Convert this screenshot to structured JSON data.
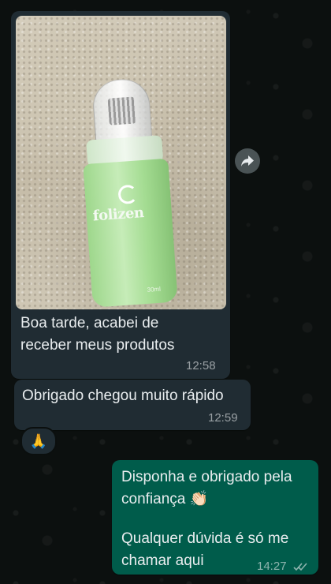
{
  "messages": [
    {
      "direction": "incoming",
      "type": "image",
      "image": {
        "product_brand": "folizen",
        "bottle_small_print": "30ml"
      },
      "text": "Boa tarde, acabei de receber meus produtos",
      "time": "12:58"
    },
    {
      "direction": "incoming",
      "type": "text",
      "text": "Obrigado chegou muito rápido",
      "time": "12:59",
      "reaction": "🙏"
    },
    {
      "direction": "outgoing",
      "type": "text",
      "text_line1": "Disponha e obrigado pela confiança 👏🏻",
      "text_line2": "Qualquer dúvida é só me chamar aqui",
      "time": "14:27",
      "status_icon": "double-check-icon"
    }
  ],
  "icons": {
    "forward": "forward-arrow-icon"
  },
  "colors": {
    "incoming_bubble": "#202c33",
    "outgoing_bubble": "#005c4b",
    "background": "#0b0f0e",
    "text": "#e9edef"
  }
}
